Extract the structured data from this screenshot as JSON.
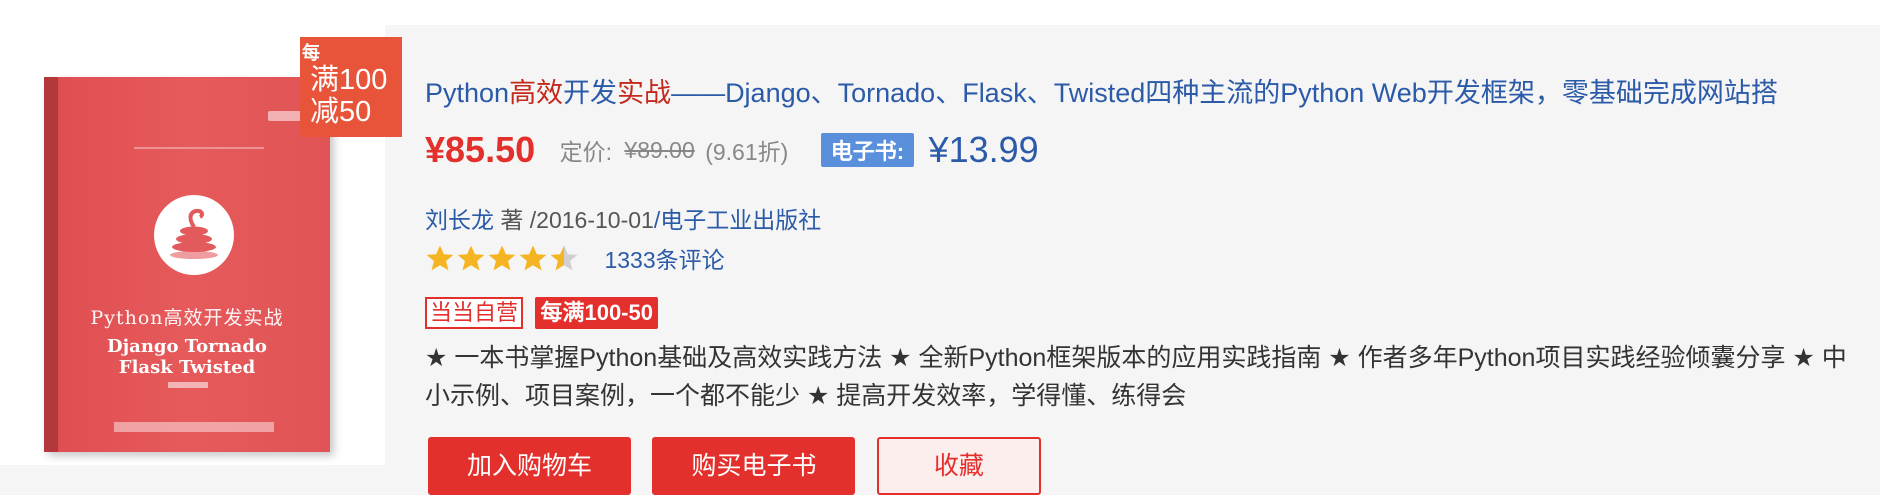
{
  "product": {
    "promo_tag": {
      "prefix": "每",
      "line1": "满100",
      "line2": "减50"
    },
    "cover": {
      "title_cn": "Python高效开发实战",
      "title_en_line1": "Django Tornado",
      "title_en_line2": "Flask Twisted"
    },
    "title": {
      "part1": "Python",
      "part2": "高效",
      "part3": "开发",
      "part4": "实战",
      "part5": "——Django、Tornado、Flask、Twisted四种主流的Python Web开发框架，零基础完成网站搭"
    },
    "price": "¥85.50",
    "list_price_label": "定价:",
    "list_price": "¥89.00",
    "discount": "(9.61折)",
    "ebook_label": "电子书:",
    "ebook_price": "¥13.99",
    "author": "刘长龙",
    "author_role": " 著 ",
    "pub_date": "/2016-10-01",
    "publisher": "/电子工业出版社",
    "rating": 4.5,
    "review_count": "1333条评论",
    "badges": {
      "self_operated": "当当自营",
      "promotion": "每满100-50"
    },
    "description": "★ 一本书掌握Python基础及高效实践方法 ★ 全新Python框架版本的应用实践指南 ★ 作者多年Python项目实践经验倾囊分享 ★ 中小示例、项目案例，一个都不能少 ★ 提高开发效率，学得懂、练得会",
    "buttons": {
      "add_to_cart": "加入购物车",
      "buy_ebook": "购买电子书",
      "favorite": "收藏"
    }
  },
  "colors": {
    "accent_red": "#e3302d",
    "link_blue": "#2a5aa8",
    "ebook_blue": "#5a8fdc",
    "promo_orange": "#e8543a",
    "star_gold": "#f5b523"
  }
}
